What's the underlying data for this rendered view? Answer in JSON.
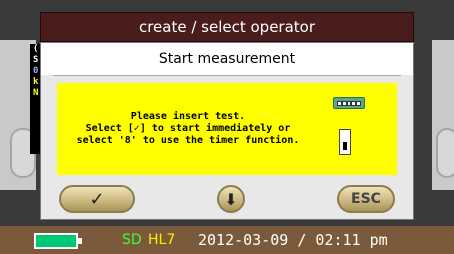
{
  "window": {
    "title": "create / select operator"
  },
  "background": {
    "strip_chars": [
      "(",
      "S",
      "0",
      "k",
      "N"
    ]
  },
  "dialog": {
    "title": "Start measurement",
    "message_lines": [
      "Please insert test.",
      "Select [✓] to start immediately or",
      "select '8' to use the timer function."
    ],
    "icons": [
      "connector-icon",
      "switch-icon"
    ]
  },
  "buttons": {
    "confirm": "✓",
    "down": "⬇",
    "escape": "ESC"
  },
  "status_bar": {
    "battery_color": "#00c878",
    "sd_label": "SD",
    "hl7_label": "HL7",
    "datetime": "2012-03-09 / 02:11 pm"
  }
}
